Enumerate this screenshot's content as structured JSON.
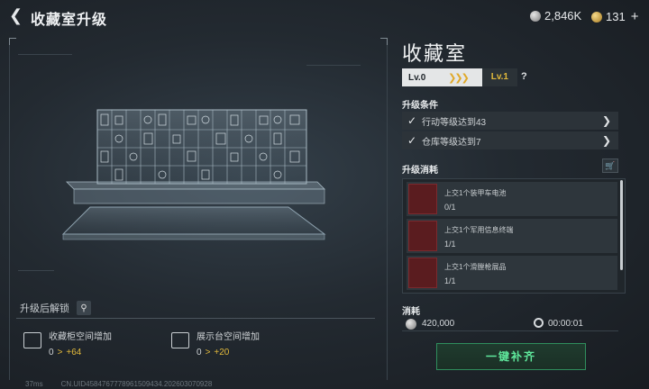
{
  "header": {
    "title": "收藏室升级",
    "silver_amount": "2,846K",
    "gold_amount": "131"
  },
  "room": {
    "name": "收藏室",
    "level_from": "Lv.0",
    "level_to": "Lv.1",
    "help": "?"
  },
  "conditions": {
    "title": "升级条件",
    "items": [
      {
        "label": "行动等级达到43"
      },
      {
        "label": "仓库等级达到7"
      }
    ]
  },
  "costs": {
    "title": "升级消耗",
    "items": [
      {
        "name": "上交1个装甲车电池",
        "count": "0/1"
      },
      {
        "name": "上交1个军用信息终端",
        "count": "1/1"
      },
      {
        "name": "上交1个滑膛枪展品",
        "count": "1/1"
      }
    ]
  },
  "consume": {
    "title": "消耗",
    "money": "420,000",
    "time": "00:00:01"
  },
  "confirm_label": "一键补齐",
  "unlock": {
    "title": "升级后解锁",
    "items": [
      {
        "label": "收藏柜空间增加",
        "from": "0",
        "arrow": ">",
        "to": "+64"
      },
      {
        "label": "展示台空间增加",
        "from": "0",
        "arrow": ">",
        "to": "+20"
      }
    ]
  },
  "footer": {
    "ping": "37ms",
    "uid": "CN.UID4584767778961509434.202603070928"
  },
  "colors": {
    "accent_gold": "#e2b93b",
    "confirm_green": "#5fe89c",
    "cost_red": "#5a1c1f"
  }
}
